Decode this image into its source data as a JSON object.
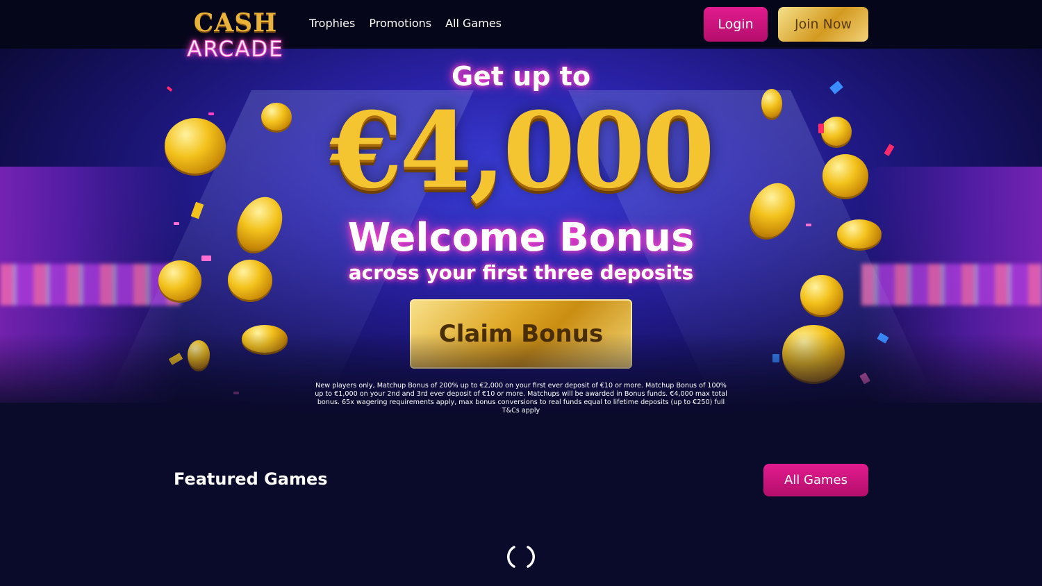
{
  "header": {
    "logo_top": "CASH",
    "logo_bottom": "ARCADE",
    "nav": [
      "Trophies",
      "Promotions",
      "All Games"
    ],
    "login_label": "Login",
    "join_label": "Join Now"
  },
  "hero": {
    "get_up_to": "Get up to",
    "amount": "€4,000",
    "welcome": "Welcome Bonus",
    "subtitle": "across your first three deposits",
    "claim_label": "Claim Bonus",
    "terms": "New players only, Matchup Bonus of 200% up to €2,000 on your first ever deposit of €10 or more. Matchup Bonus of 100% up to €1,000 on your 2nd and 3rd ever deposit of €10 or more. Matchups will be awarded in Bonus funds. €4,000 max total bonus. 65x wagering requirements apply, max bonus conversions to real funds equal to lifetime deposits (up to €250) full T&Cs apply"
  },
  "featured": {
    "title": "Featured Games",
    "all_games_label": "All Games"
  },
  "colors": {
    "background": "#0a0a2a",
    "pink_button": "#e21b8e",
    "gold": "#f5c531"
  }
}
